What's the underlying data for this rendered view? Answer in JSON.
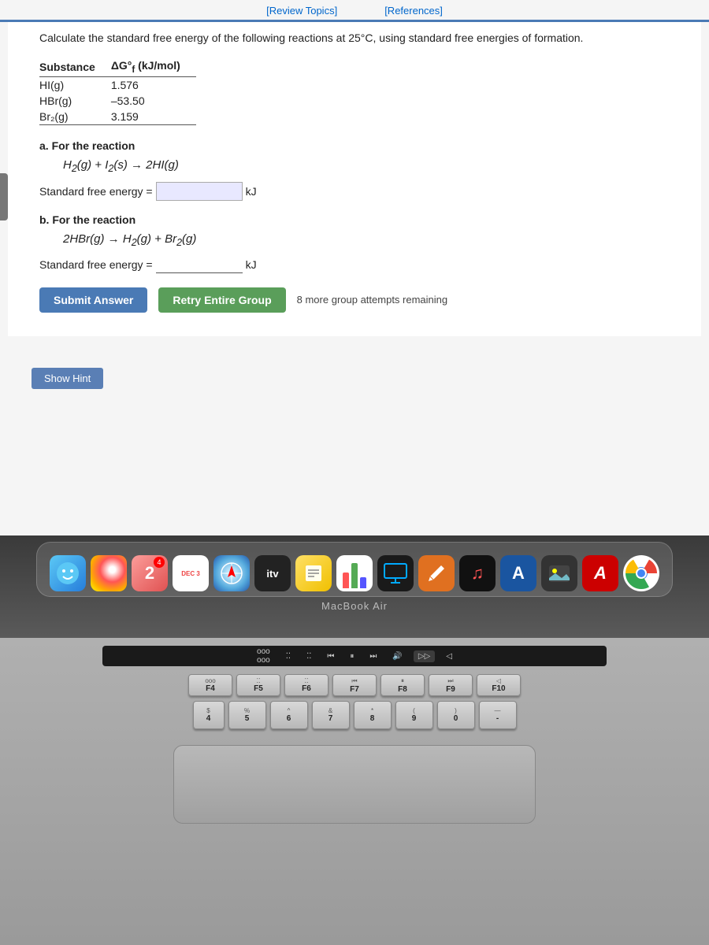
{
  "top_links": {
    "review_topics": "[Review Topics]",
    "references": "[References]"
  },
  "question": {
    "intro": "Calculate the standard free energy of the following reactions at 25°C, using standard free energies of formation.",
    "table": {
      "headers": [
        "Substance",
        "ΔG°f (kJ/mol)"
      ],
      "rows": [
        [
          "HI(g)",
          "1.576"
        ],
        [
          "HBr(g)",
          "–53.50"
        ],
        [
          "Br₂(g)",
          "3.159"
        ]
      ]
    },
    "part_a": {
      "label": "a. For the reaction",
      "reaction": "H₂(g) + I₂(s) → 2HI(g)",
      "energy_label": "Standard free energy =",
      "energy_unit": "kJ",
      "energy_placeholder": ""
    },
    "part_b": {
      "label": "b. For the reaction",
      "reaction": "2HBr(g) → H₂(g) + Br₂(g)",
      "energy_label": "Standard free energy =",
      "energy_unit": "kJ",
      "energy_placeholder": ""
    },
    "buttons": {
      "submit": "Submit Answer",
      "retry": "Retry Entire Group",
      "attempts": "8 more group attempts remaining"
    },
    "hint": {
      "label": "Show Hint"
    }
  },
  "dock": {
    "label": "MacBook Air",
    "icons": [
      {
        "name": "finder",
        "symbol": "😊",
        "label": ""
      },
      {
        "name": "photos",
        "symbol": "🌸",
        "label": ""
      },
      {
        "name": "music-app",
        "symbol": "2",
        "label": ""
      },
      {
        "name": "calendar",
        "symbol": "📅",
        "label": ""
      },
      {
        "name": "safari",
        "symbol": "🌐",
        "label": ""
      },
      {
        "name": "itv",
        "symbol": "itv",
        "label": ""
      },
      {
        "name": "notes",
        "symbol": "📝",
        "label": ""
      },
      {
        "name": "charts",
        "symbol": "📊",
        "label": ""
      },
      {
        "name": "screen",
        "symbol": "🖥",
        "label": ""
      },
      {
        "name": "pencil",
        "symbol": "✒",
        "label": ""
      },
      {
        "name": "music2",
        "symbol": "♫",
        "label": ""
      },
      {
        "name": "aa",
        "symbol": "A",
        "label": ""
      },
      {
        "name": "img",
        "symbol": "🖼",
        "label": ""
      },
      {
        "name": "acrobat",
        "symbol": "A",
        "label": ""
      },
      {
        "name": "chrome",
        "symbol": "🟢",
        "label": ""
      }
    ]
  },
  "keyboard": {
    "fn_row": [
      "F4",
      "F5",
      "F6",
      "F7",
      "F8",
      "F9",
      "F10"
    ],
    "row1": [
      "$",
      "%",
      "^",
      "&",
      "*",
      "(",
      ")",
      "—"
    ],
    "row1_top": [
      "4",
      "5",
      "6",
      "7",
      "8",
      "9",
      "0",
      ""
    ],
    "touchbar_items": [
      "⏮",
      "⏯",
      "⏭",
      "🔊"
    ]
  }
}
